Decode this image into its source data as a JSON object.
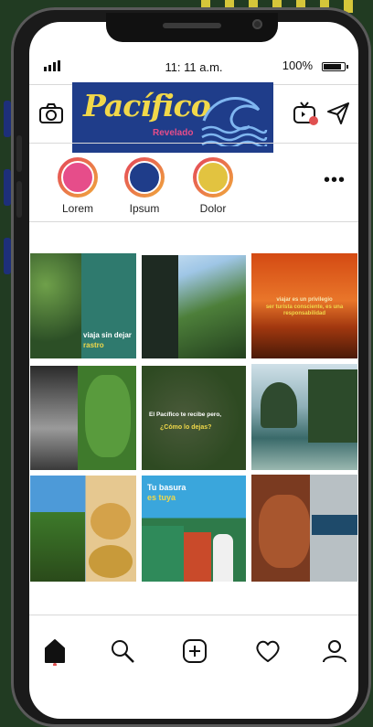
{
  "status": {
    "time": "11: 11 a.m.",
    "battery": "100%"
  },
  "header": {
    "logo_title": "Pacífico",
    "logo_subtitle": "Revelado",
    "notification_color": "#e05050"
  },
  "stories": [
    {
      "label": "Lorem",
      "color": "#e64d8a"
    },
    {
      "label": "Ipsum",
      "color": "#1f3d8a"
    },
    {
      "label": "Dolor",
      "color": "#e2c340"
    }
  ],
  "posts": [
    {
      "text1": "viaja sin dejar",
      "text2": "rastro",
      "accent": "#f1d84a"
    },
    {},
    {
      "text1": "viajar es un privilegio",
      "text2": "ser turista consciente, es una responsabilidad",
      "accent": "#f1d84a"
    },
    {},
    {
      "text1": "El Pacífico te recibe pero,",
      "text2": "¿Cómo lo dejas?",
      "accent": "#f1d84a"
    },
    {},
    {},
    {
      "text1": "Tu basura",
      "text2": "es tuya",
      "accent": "#f1d84a"
    },
    {}
  ],
  "nav": [
    "home-icon",
    "search-icon",
    "add-icon",
    "heart-icon",
    "profile-icon"
  ]
}
